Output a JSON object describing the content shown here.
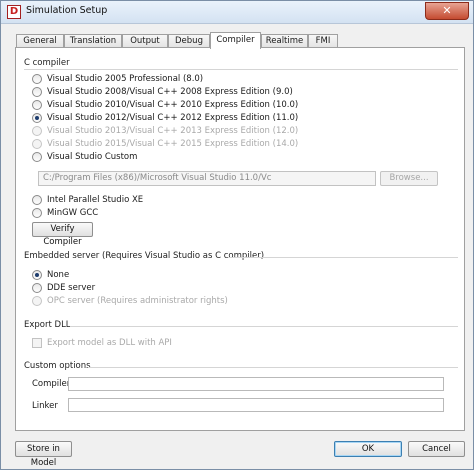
{
  "window": {
    "title": "Simulation Setup",
    "close_symbol": "✕"
  },
  "tabs": [
    {
      "label": "General",
      "active": false
    },
    {
      "label": "Translation",
      "active": false
    },
    {
      "label": "Output",
      "active": false
    },
    {
      "label": "Debug",
      "active": false
    },
    {
      "label": "Compiler",
      "active": true
    },
    {
      "label": "Realtime",
      "active": false
    },
    {
      "label": "FMI",
      "active": false
    }
  ],
  "c_compiler": {
    "title": "C compiler",
    "options": [
      {
        "label": "Visual Studio 2005 Professional (8.0)",
        "checked": false,
        "enabled": true
      },
      {
        "label": "Visual Studio 2008/Visual C++ 2008 Express Edition (9.0)",
        "checked": false,
        "enabled": true
      },
      {
        "label": "Visual Studio 2010/Visual C++ 2010 Express Edition (10.0)",
        "checked": false,
        "enabled": true
      },
      {
        "label": "Visual Studio 2012/Visual C++ 2012 Express Edition (11.0)",
        "checked": true,
        "enabled": true
      },
      {
        "label": "Visual Studio 2013/Visual C++ 2013 Express Edition (12.0)",
        "checked": false,
        "enabled": false
      },
      {
        "label": "Visual Studio 2015/Visual C++ 2015 Express Edition (14.0)",
        "checked": false,
        "enabled": false
      },
      {
        "label": "Visual Studio Custom",
        "checked": false,
        "enabled": true
      }
    ],
    "custom_path_value": "C:/Program Files (x86)/Microsoft Visual Studio 11.0/Vc",
    "browse_label": "Browse...",
    "other_options": [
      {
        "label": "Intel Parallel Studio XE",
        "checked": false,
        "enabled": true
      },
      {
        "label": "MinGW GCC",
        "checked": false,
        "enabled": true
      }
    ],
    "verify_label": "Verify Compiler"
  },
  "embedded_server": {
    "title": "Embedded server (Requires Visual Studio as C compiler)",
    "options": [
      {
        "label": "None",
        "checked": true,
        "enabled": true
      },
      {
        "label": "DDE server",
        "checked": false,
        "enabled": true
      },
      {
        "label": "OPC server (Requires administrator rights)",
        "checked": false,
        "enabled": false
      }
    ]
  },
  "export_dll": {
    "title": "Export DLL",
    "checkbox_label": "Export model as DLL with API",
    "checked": false,
    "enabled": false
  },
  "custom_options": {
    "title": "Custom options",
    "compiler_label": "Compiler",
    "compiler_value": "",
    "linker_label": "Linker",
    "linker_value": ""
  },
  "footer": {
    "store_label": "Store in Model",
    "ok_label": "OK",
    "cancel_label": "Cancel"
  }
}
